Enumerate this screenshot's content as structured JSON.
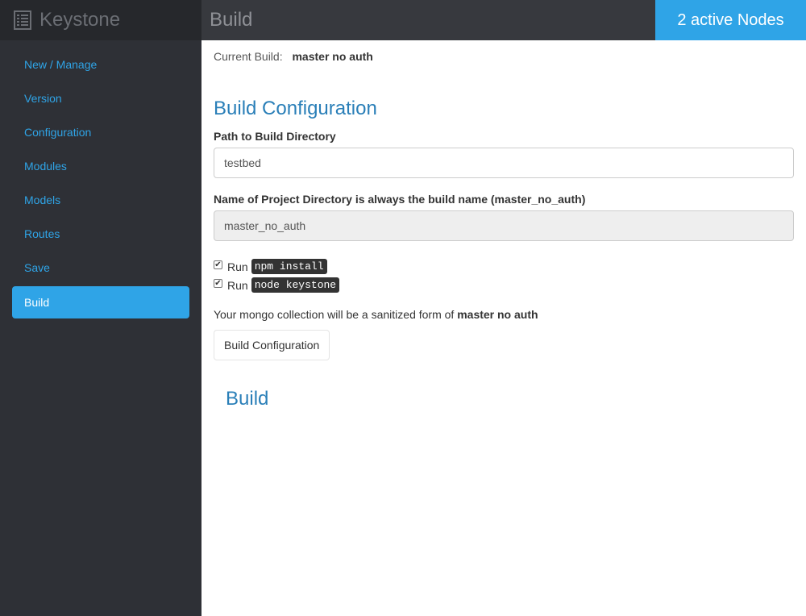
{
  "brand": {
    "name": "Keystone",
    "icon": "list-icon"
  },
  "sidebar": {
    "items": [
      {
        "label": "New / Manage"
      },
      {
        "label": "Version"
      },
      {
        "label": "Configuration"
      },
      {
        "label": "Modules"
      },
      {
        "label": "Models"
      },
      {
        "label": "Routes"
      },
      {
        "label": "Save"
      },
      {
        "label": "Build",
        "active": true
      }
    ]
  },
  "header": {
    "title": "Build",
    "nodes_badge": "2 active Nodes"
  },
  "main": {
    "current_build_label": "Current Build:",
    "current_build_value": "master no auth",
    "config_heading": "Build Configuration",
    "path_label": "Path to Build Directory",
    "path_value": "testbed",
    "project_label": "Name of Project Directory is always the build name (master_no_auth)",
    "project_value": "master_no_auth",
    "checks": [
      {
        "prefix": "Run",
        "code": "npm install",
        "checked": true
      },
      {
        "prefix": "Run",
        "code": "node keystone",
        "checked": true
      }
    ],
    "mongo_text": "Your mongo collection will be a sanitized form of",
    "mongo_value": "master no auth",
    "button_label": "Build Configuration",
    "build_heading": "Build"
  },
  "colors": {
    "accent": "#2fa4e7",
    "sidebar_bg": "#2e3036",
    "heading": "#2a7fb8"
  }
}
